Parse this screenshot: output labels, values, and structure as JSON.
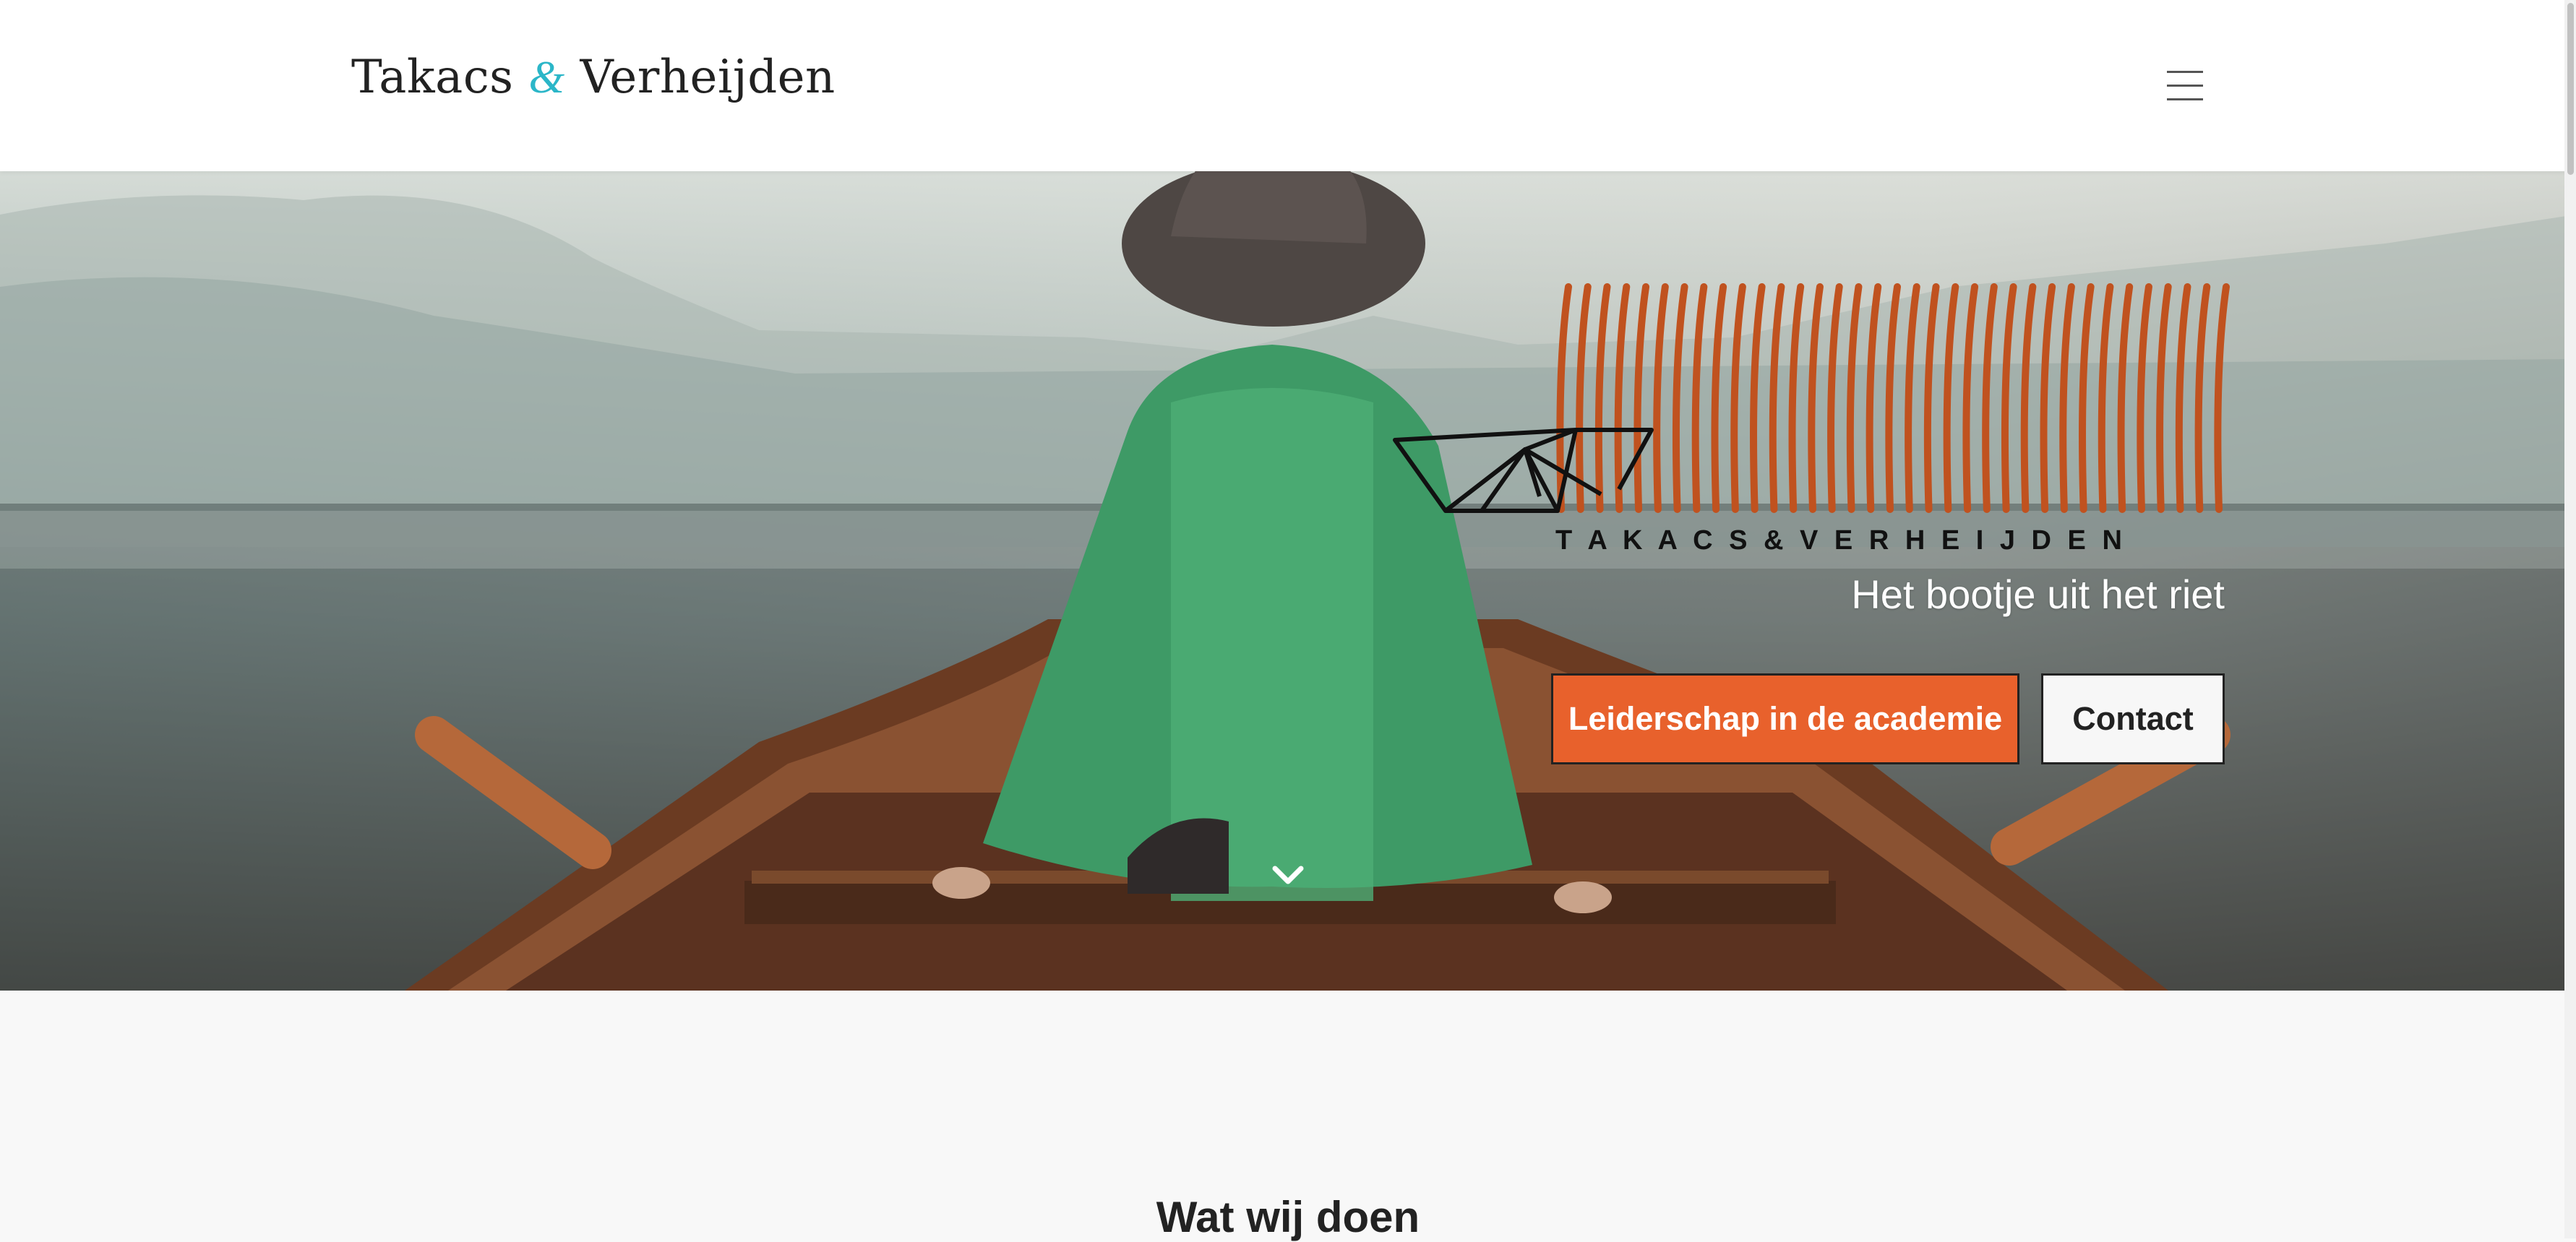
{
  "header": {
    "logo": {
      "part1": "Takacs",
      "ampersand": "&",
      "part2": "Verheijden"
    },
    "menu_icon": "hamburger-icon",
    "accent_color": "#2bb6c8"
  },
  "hero": {
    "logo_caption": "T A K A C S & V E R H E I J D E N",
    "logo_stripe_color": "#c0521f",
    "tagline": "Het bootje uit het riet",
    "primary_button": "Leiderschap in de academie",
    "secondary_button": "Contact",
    "primary_color": "#e8612c",
    "scroll_icon": "chevron-down-icon"
  },
  "section": {
    "heading": "Wat wij doen"
  }
}
